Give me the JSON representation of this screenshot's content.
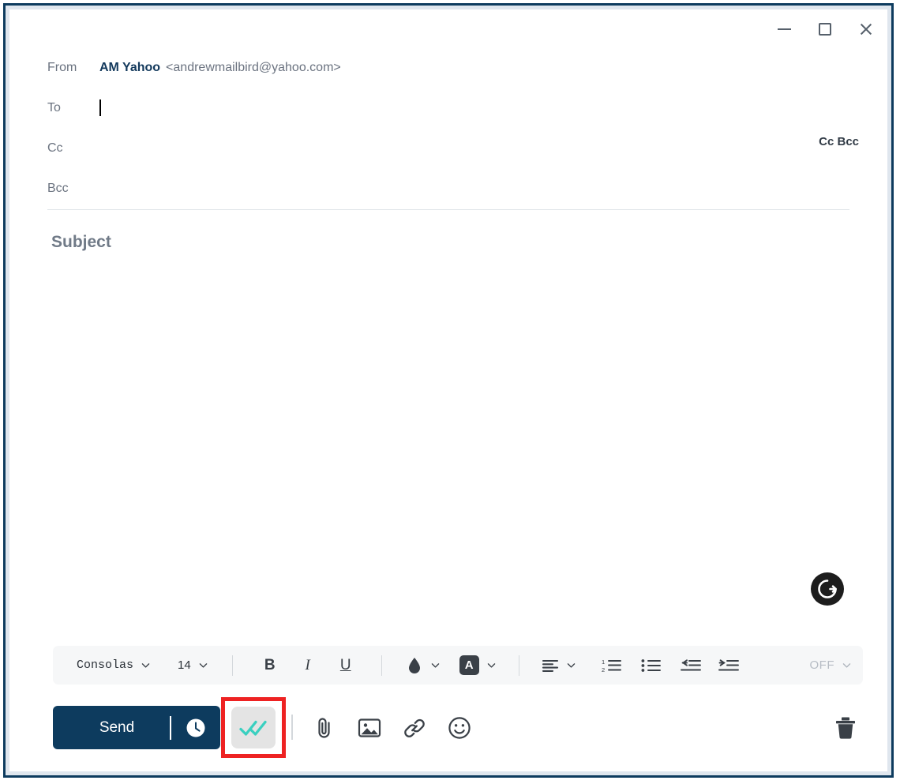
{
  "window": {
    "controls": {
      "minimize_label": "Minimize",
      "maximize_label": "Maximize",
      "close_label": "Close"
    },
    "border_color": "#0d3b5e"
  },
  "compose": {
    "from": {
      "label": "From",
      "account_name": "AM Yahoo",
      "account_email": "<andrewmailbird@yahoo.com>"
    },
    "to": {
      "label": "To",
      "value": "",
      "focused": true
    },
    "cc": {
      "label": "Cc",
      "value": ""
    },
    "bcc": {
      "label": "Bcc",
      "value": ""
    },
    "ccbcc_toggle": "Cc Bcc",
    "subject": {
      "placeholder": "Subject",
      "value": ""
    },
    "body": {
      "value": ""
    },
    "grammarly_badge": "G"
  },
  "toolbar": {
    "font_family": "Consolas",
    "font_size": "14",
    "bold_label": "B",
    "italic_label": "I",
    "underline_label": "U",
    "highlight_label": "A",
    "tracking_label": "OFF"
  },
  "actions": {
    "send_label": "Send",
    "schedule_tooltip": "Schedule send",
    "read_receipt_tooltip": "Read receipt",
    "attach_tooltip": "Attach file",
    "image_tooltip": "Insert image",
    "link_tooltip": "Insert link",
    "emoji_tooltip": "Insert emoji",
    "discard_tooltip": "Discard draft"
  },
  "colors": {
    "accent": "#0d3b5e",
    "highlight_box": "#ee2222",
    "check_teal": "#3ad0c0",
    "toolbar_bg": "#f6f7f8"
  }
}
